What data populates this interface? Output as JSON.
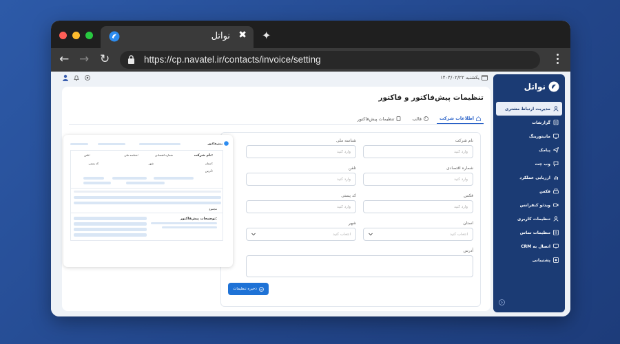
{
  "browser": {
    "tab_title": "نواتل",
    "tab_close": "✖",
    "new_tab": "✦",
    "url": "https://cp.navatel.ir/contacts/invoice/setting",
    "back": "←",
    "forward": "→",
    "reload": "↻"
  },
  "topbar": {
    "date": "یکشنبه ۱۴۰۴/۰۲/۲۲"
  },
  "brand": {
    "name": "نواتل",
    "color": "#1b3b74"
  },
  "sidebar": {
    "items": [
      {
        "label": "مدیریت ارتباط مشتری",
        "icon": "user-icon"
      },
      {
        "label": "گزارشات",
        "icon": "report-icon"
      },
      {
        "label": "مانیتورینگ",
        "icon": "monitor-icon"
      },
      {
        "label": "پیامک",
        "icon": "send-icon"
      },
      {
        "label": "وب چت",
        "icon": "chat-icon"
      },
      {
        "label": "ارزیابی عملکرد",
        "icon": "chart-icon"
      },
      {
        "label": "فکس",
        "icon": "fax-icon"
      },
      {
        "label": "ویدئو کنفرانس",
        "icon": "video-icon"
      },
      {
        "label": "تنظیمات کاربری",
        "icon": "user-settings-icon"
      },
      {
        "label": "تنظیمات تماس",
        "icon": "phone-settings-icon"
      },
      {
        "label": "اتصال به CRM",
        "icon": "crm-icon"
      },
      {
        "label": "پشتیبانی",
        "icon": "support-icon"
      }
    ]
  },
  "page": {
    "title": "تنظیمات پیش‌فاکتور و فاکتور",
    "tabs": [
      {
        "label": "اطلاعات شرکت",
        "icon": "home-icon",
        "active": true
      },
      {
        "label": "قالب",
        "icon": "palette-icon",
        "active": false
      },
      {
        "label": "تنظیمات پیش‌فاکتور",
        "icon": "doc-icon",
        "active": false
      }
    ]
  },
  "form": {
    "company_name": {
      "label": "نام شرکت",
      "placeholder": "وارد کنید"
    },
    "national_id": {
      "label": "شناسه ملی",
      "placeholder": "وارد کنید"
    },
    "economic_code": {
      "label": "شماره اقتصادی",
      "placeholder": "وارد کنید"
    },
    "phone": {
      "label": "تلفن",
      "placeholder": "وارد کنید"
    },
    "fax": {
      "label": "فکس",
      "placeholder": "وارد کنید"
    },
    "postal_code": {
      "label": "کد پستی",
      "placeholder": "وارد کنید"
    },
    "province": {
      "label": "استان",
      "placeholder": "انتخاب کنید"
    },
    "city": {
      "label": "شهر",
      "placeholder": "انتخاب کنید"
    },
    "address": {
      "label": "آدرس",
      "placeholder": ""
    },
    "save_label": "ذخیره تنظیمات",
    "accent": "#1e72d6"
  },
  "preview": {
    "header_title": "پیش‌فاکتور",
    "company_label": "نام شرکت:",
    "economic_label": "شماره اقتصادی",
    "national_label": "شناسه ملی:",
    "phone_label": "تلفن:",
    "province_label": "استان:",
    "city_label": "شهر",
    "postal_label": "کد پستی",
    "address_label": "آدرس:",
    "total_label": "مجموع",
    "desc_title": "توضیحات پیش‌فاکتور:"
  }
}
